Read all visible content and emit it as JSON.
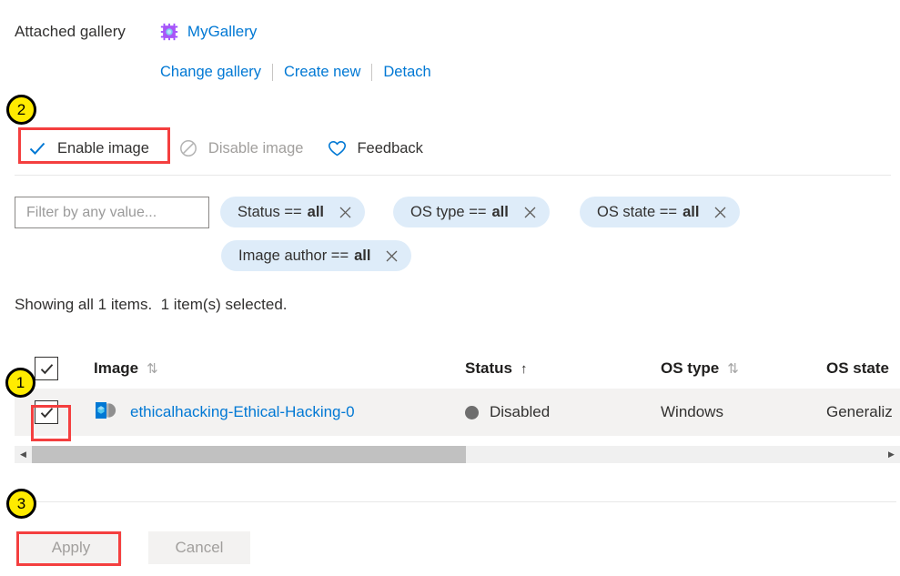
{
  "gallery": {
    "label": "Attached gallery",
    "icon": "gallery-chip-icon",
    "name": "MyGallery",
    "actions": [
      {
        "label": "Change gallery"
      },
      {
        "label": "Create new"
      },
      {
        "label": "Detach"
      }
    ]
  },
  "toolbar": {
    "commands": [
      {
        "label": "Enable image",
        "icon": "checkmark-icon",
        "state": "enabled"
      },
      {
        "label": "Disable image",
        "icon": "block-icon",
        "state": "disabled"
      },
      {
        "label": "Feedback",
        "icon": "heart-icon",
        "state": "enabled"
      }
    ]
  },
  "filters": {
    "search_placeholder": "Filter by any value...",
    "search_value": "",
    "pills": [
      {
        "field": "Status ==",
        "value": "all",
        "remove_icon": "close-icon"
      },
      {
        "field": "OS type ==",
        "value": "all",
        "remove_icon": "close-icon"
      },
      {
        "field": "OS state ==",
        "value": "all",
        "remove_icon": "close-icon"
      },
      {
        "field": "Image author ==",
        "value": "all",
        "remove_icon": "close-icon"
      }
    ]
  },
  "status_line": "Showing all 1 items.  1 item(s) selected.",
  "table": {
    "select_all_checked": true,
    "columns": [
      {
        "label": "Image",
        "sort": "both"
      },
      {
        "label": "Status",
        "sort": "asc"
      },
      {
        "label": "OS type",
        "sort": "both"
      },
      {
        "label": "OS state",
        "sort": "none"
      }
    ],
    "rows": [
      {
        "checked": true,
        "icon": "azure-image-icon",
        "name": "ethicalhacking-Ethical-Hacking-0",
        "status": "Disabled",
        "status_color": "#6e6e6e",
        "os_type": "Windows",
        "os_state": "Generaliz"
      }
    ],
    "scrollbar": {
      "left_arrow": "chevron-left-icon",
      "right_arrow": "chevron-right-icon"
    }
  },
  "footer": {
    "apply_label": "Apply",
    "cancel_label": "Cancel"
  },
  "annotations": {
    "badges": [
      {
        "number": "1"
      },
      {
        "number": "2"
      },
      {
        "number": "3"
      }
    ],
    "highlight_color": "#f43f3f",
    "badge_color": "#ffeb00"
  }
}
